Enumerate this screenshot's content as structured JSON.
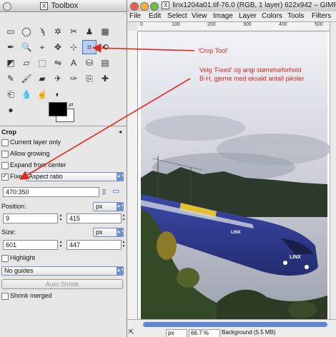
{
  "toolbox": {
    "title": "Toolbox",
    "x_badge": "X",
    "tool_options_heading": "Crop",
    "options": {
      "current_layer_only": "Current layer only",
      "allow_growing": "Allow growing",
      "expand_from_center": "Expand from center",
      "fixed_label": "Fixed:",
      "fixed_mode": "Aspect ratio",
      "ratio_value": "470:350",
      "position_label": "Position:",
      "position_unit": "px",
      "pos_x": "9",
      "pos_y": "415",
      "size_label": "Size:",
      "size_unit": "px",
      "size_w": "601",
      "size_h": "447",
      "highlight": "Highlight",
      "guides": "No guides",
      "auto_shrink": "Auto Shrink",
      "shrink_merged": "Shrink merged"
    },
    "checked": {
      "current_layer_only": false,
      "allow_growing": false,
      "expand_from_center": false,
      "fixed": true,
      "highlight": false,
      "shrink_merged": false
    }
  },
  "image_window": {
    "x_badge": "X",
    "title": "linx1204a01.tif-76.0 (RGB, 1 layer) 622x942 – GIMP",
    "menu": [
      "File",
      "Edit",
      "Select",
      "View",
      "Image",
      "Layer",
      "Colors",
      "Tools",
      "Filters"
    ],
    "ruler_ticks": [
      "0",
      "100",
      "200",
      "300",
      "400",
      "500"
    ],
    "status_unit": "px",
    "zoom": "66.7 %",
    "status_info": "Background (5.5 MB)"
  },
  "annotations": {
    "crop_tool": "'Crop Tool'",
    "instruction_line1": "Velg 'Fixed' og angi størrelseforhold",
    "instruction_line2": "B-H, gjerne med eksakt antall piksler"
  },
  "colors": {
    "annotation": "#e0281e",
    "accent": "#5f87d6",
    "train": "#2e3a8f"
  }
}
